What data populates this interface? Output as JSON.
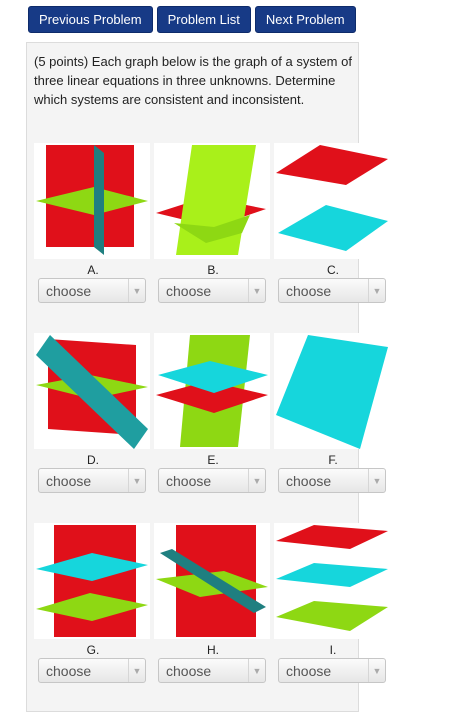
{
  "nav": {
    "previous_label": "Previous Problem",
    "list_label": "Problem List",
    "next_label": "Next Problem"
  },
  "question": {
    "text": "(5 points) Each graph below is the graph of a system of three linear equations in three unknowns. Determine which systems are consistent and inconsistent."
  },
  "colors": {
    "red": "#e0101a",
    "green": "#8ed813",
    "cyan": "#16d6dc",
    "teal": "#1f7f80",
    "nav": "#173a86"
  },
  "graphs": [
    {
      "label": "A.",
      "select_value": "choose"
    },
    {
      "label": "B.",
      "select_value": "choose"
    },
    {
      "label": "C.",
      "select_value": "choose"
    },
    {
      "label": "D.",
      "select_value": "choose"
    },
    {
      "label": "E.",
      "select_value": "choose"
    },
    {
      "label": "F.",
      "select_value": "choose"
    },
    {
      "label": "G.",
      "select_value": "choose"
    },
    {
      "label": "H.",
      "select_value": "choose"
    },
    {
      "label": "I.",
      "select_value": "choose"
    }
  ]
}
